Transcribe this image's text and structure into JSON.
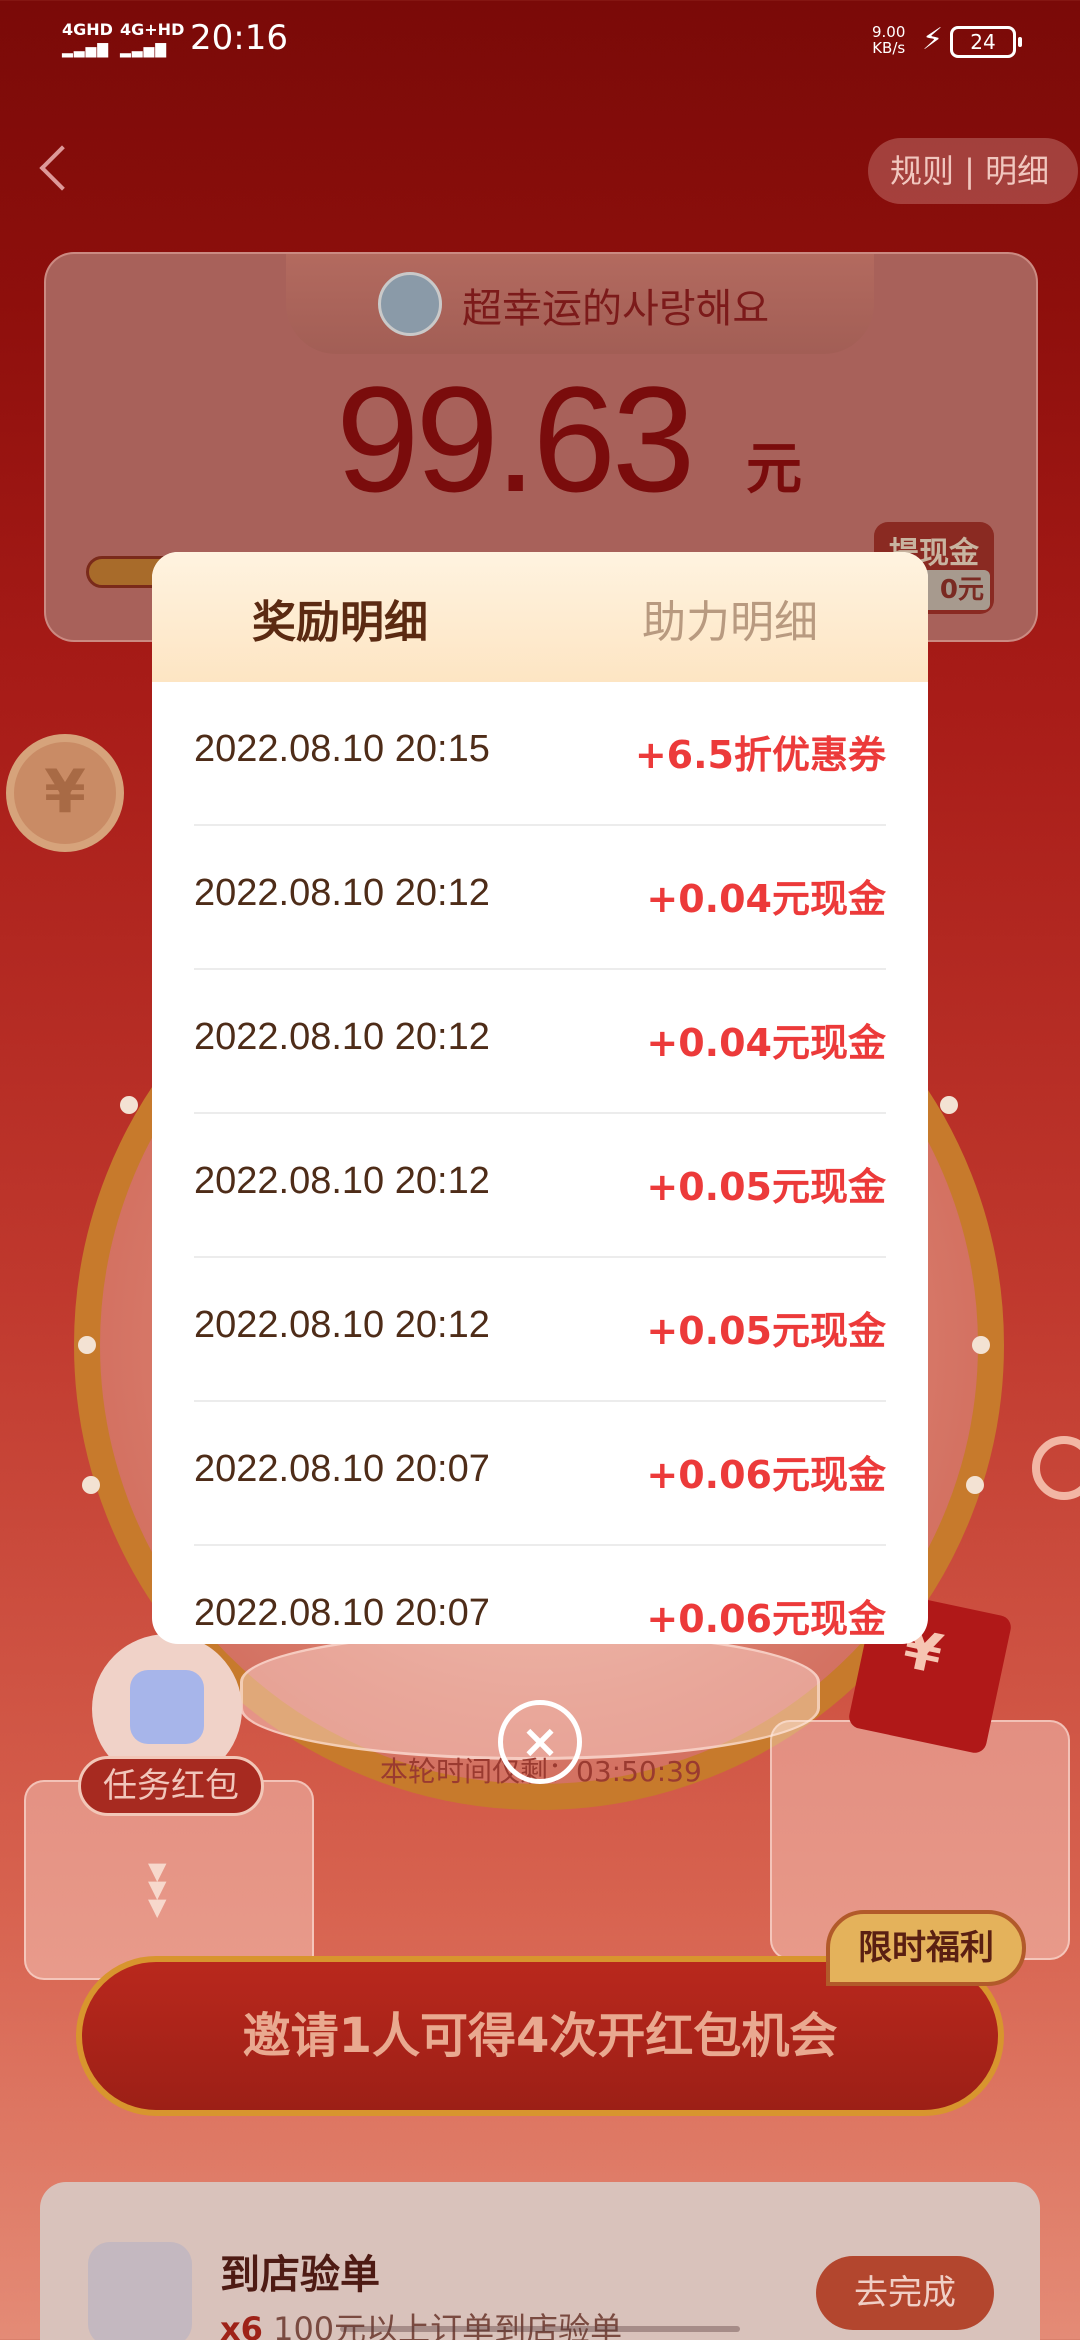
{
  "status_bar": {
    "signal1": "4GHD",
    "signal2": "4G+HD",
    "time": "20:16",
    "speed_value": "9.00",
    "speed_unit": "KB/s",
    "battery": "24"
  },
  "header": {
    "rules_label": "规则 | 明细"
  },
  "balance_card": {
    "username": "超幸运的사랑해요",
    "amount": "99.63",
    "unit": "元",
    "cashout_label": "提现金",
    "cashout_value": "0元"
  },
  "background": {
    "task_redpacket_label": "任务红包",
    "timer_text": "本轮时间仅剩：03:50:39",
    "invite_label": "邀请1人可得4次开红包机会",
    "limited_badge": "限时福利",
    "task_card": {
      "title": "到店验单",
      "multiplier": "x6",
      "subtitle": "100元以上订单到店验单",
      "button": "去完成"
    }
  },
  "modal": {
    "tabs": [
      {
        "label": "奖励明细",
        "active": true
      },
      {
        "label": "助力明细",
        "active": false
      }
    ],
    "records": [
      {
        "datetime": "2022.08.10 20:15",
        "reward": "+6.5折优惠券"
      },
      {
        "datetime": "2022.08.10 20:12",
        "reward": "+0.04元现金"
      },
      {
        "datetime": "2022.08.10 20:12",
        "reward": "+0.04元现金"
      },
      {
        "datetime": "2022.08.10 20:12",
        "reward": "+0.05元现金"
      },
      {
        "datetime": "2022.08.10 20:12",
        "reward": "+0.05元现金"
      },
      {
        "datetime": "2022.08.10 20:07",
        "reward": "+0.06元现金"
      },
      {
        "datetime": "2022.08.10 20:07",
        "reward": "+0.06元现金"
      }
    ],
    "close_icon": "close-circle-icon"
  },
  "colors": {
    "accent_red": "#ec3a3a",
    "tab_active": "#5b2a12",
    "tab_inactive": "#b89a80"
  }
}
